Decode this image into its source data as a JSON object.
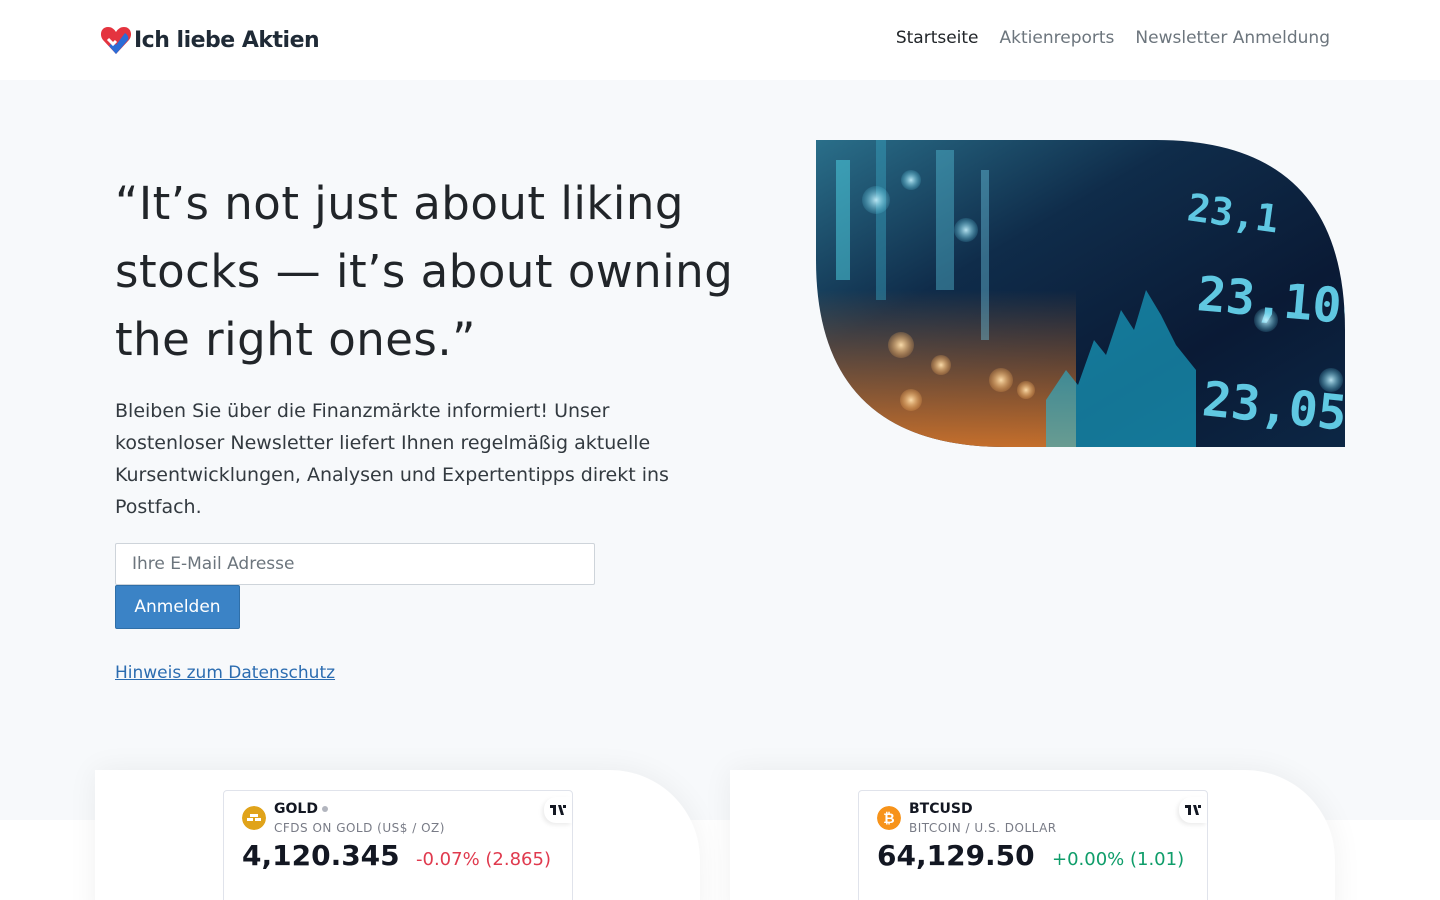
{
  "header": {
    "brand": "Ich liebe Aktien",
    "nav": [
      {
        "label": "Startseite",
        "active": true
      },
      {
        "label": "Aktienreports",
        "active": false
      },
      {
        "label": "Newsletter Anmeldung",
        "active": false
      }
    ]
  },
  "hero": {
    "quote": "“It’s not just about liking stocks — it’s about owning the right ones.”",
    "lead": "Bleiben Sie über die Finanzmärkte informiert! Unser kostenloser Newsletter liefert Ihnen regelmäßig aktuelle Kursentwicklungen, Analysen und Expertentipps direkt ins Postfach.",
    "email_placeholder": "Ihre E-Mail Adresse",
    "submit_label": "Anmelden",
    "privacy_link": "Hinweis zum Datenschutz"
  },
  "tickers": [
    {
      "symbol": "GOLD",
      "description": "CFDS ON GOLD (US$ / OZ)",
      "price": "4,120.345",
      "change": "-0.07% (2.865)",
      "direction": "down",
      "icon": "gold-bars-icon",
      "icon_color": "#e0a31a"
    },
    {
      "symbol": "BTCUSD",
      "description": "BITCOIN / U.S. DOLLAR",
      "price": "64,129.50",
      "change": "+0.00% (1.01)",
      "direction": "up",
      "icon": "bitcoin-icon",
      "icon_color": "#f7931a"
    }
  ],
  "colors": {
    "accent": "#3b83c6",
    "link": "#2b6cb0",
    "negative": "#e03a4e",
    "positive": "#0f9d6a",
    "hero_bg": "#f7f9fb"
  }
}
